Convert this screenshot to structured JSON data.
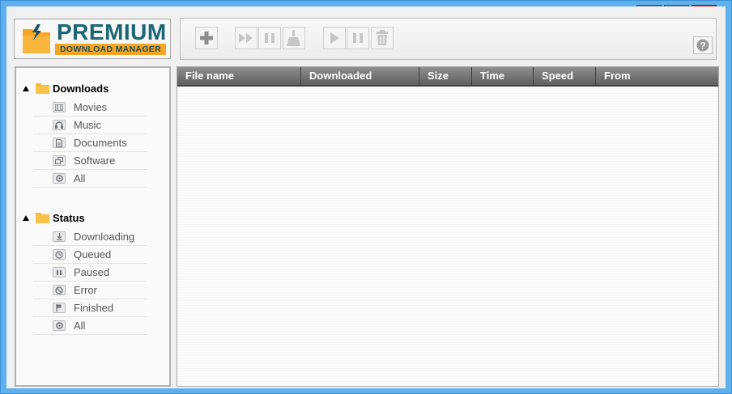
{
  "app": {
    "logo_main": "PREMIUM",
    "logo_sub": "DOWNLOAD MANAGER"
  },
  "toolbar": {
    "buttons": [
      "add-icon",
      "resume-all-icon",
      "pause-all-icon",
      "clean-icon",
      "start-icon",
      "pause-icon",
      "delete-icon"
    ],
    "help_label": "?"
  },
  "sidebar": {
    "downloads": {
      "title": "Downloads",
      "items": [
        {
          "label": "Movies",
          "icon": "film-icon"
        },
        {
          "label": "Music",
          "icon": "headphones-icon"
        },
        {
          "label": "Documents",
          "icon": "document-icon"
        },
        {
          "label": "Software",
          "icon": "software-icon"
        },
        {
          "label": "All",
          "icon": "all-icon"
        }
      ]
    },
    "status": {
      "title": "Status",
      "items": [
        {
          "label": "Downloading",
          "icon": "download-arrow-icon"
        },
        {
          "label": "Queued",
          "icon": "clock-icon"
        },
        {
          "label": "Paused",
          "icon": "pause-small-icon"
        },
        {
          "label": "Error",
          "icon": "error-icon"
        },
        {
          "label": "Finished",
          "icon": "flag-icon"
        },
        {
          "label": "All",
          "icon": "all-icon"
        }
      ]
    }
  },
  "list": {
    "columns": [
      "File name",
      "Downloaded",
      "Size",
      "Time",
      "Speed",
      "From"
    ],
    "rows": []
  },
  "colors": {
    "frame": "#5fb1ee",
    "logo_text": "#1b6673",
    "logo_band": "#f6a623",
    "header_bg": "#6f6f6f",
    "close": "#c7342a"
  }
}
